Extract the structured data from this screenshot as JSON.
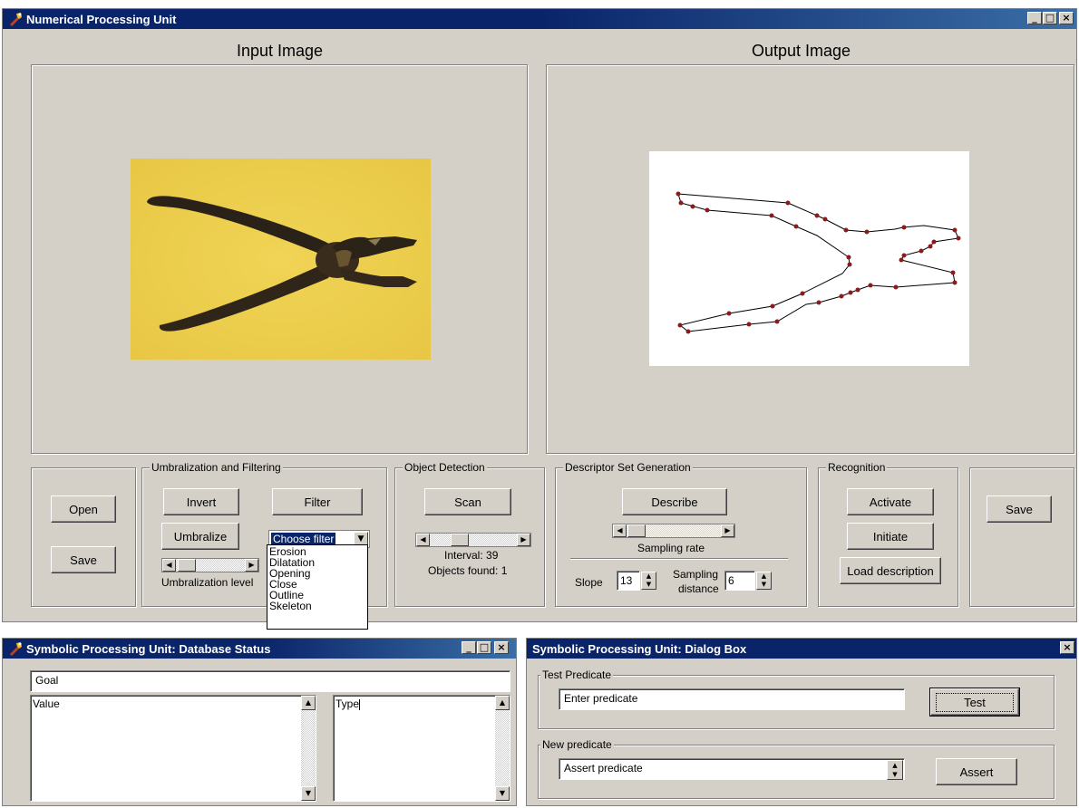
{
  "main_window": {
    "title": "Numerical Processing Unit",
    "input_caption": "Input Image",
    "output_caption": "Output Image",
    "open_label": "Open",
    "save_label": "Save",
    "umbralization": {
      "group_label": "Umbralization and Filtering",
      "invert_label": "Invert",
      "filter_label": "Filter",
      "umbralize_label": "Umbralize",
      "level_label": "Umbralization level",
      "filter_selected": "Choose filter",
      "filter_options": [
        "Erosion",
        "Dilatation",
        "Opening",
        "Close",
        "Outline",
        "Skeleton"
      ]
    },
    "object_detection": {
      "group_label": "Object Detection",
      "scan_label": "Scan",
      "interval_text": "Interval: 39",
      "objects_found_text": "Objects found: 1"
    },
    "descriptor": {
      "group_label": "Descriptor Set Generation",
      "describe_label": "Describe",
      "sampling_rate_label": "Sampling rate",
      "slope_label": "Slope",
      "slope_value": "13",
      "sampling_label_1": "Sampling",
      "sampling_label_2": "distance",
      "sampling_distance_value": "6"
    },
    "recognition": {
      "group_label": "Recognition",
      "activate_label": "Activate",
      "initiate_label": "Initiate",
      "load_label": "Load description"
    },
    "save_right_label": "Save"
  },
  "db_window": {
    "title": "Symbolic Processing Unit: Database Status",
    "goal_value": "Goal",
    "value_header": "Value",
    "type_header": "Type"
  },
  "dialog_window": {
    "title": "Symbolic Processing Unit: Dialog Box",
    "test_group_label": "Test Predicate",
    "test_input_value": "Enter predicate",
    "test_button": "Test",
    "new_group_label": "New predicate",
    "assert_input_value": "Assert predicate",
    "assert_button": "Assert"
  },
  "colors": {
    "title_bar": "#0a246a",
    "window_face": "#d4d0c8",
    "photo_background": "#efd04a",
    "outline_points": "#8b1a1a"
  }
}
